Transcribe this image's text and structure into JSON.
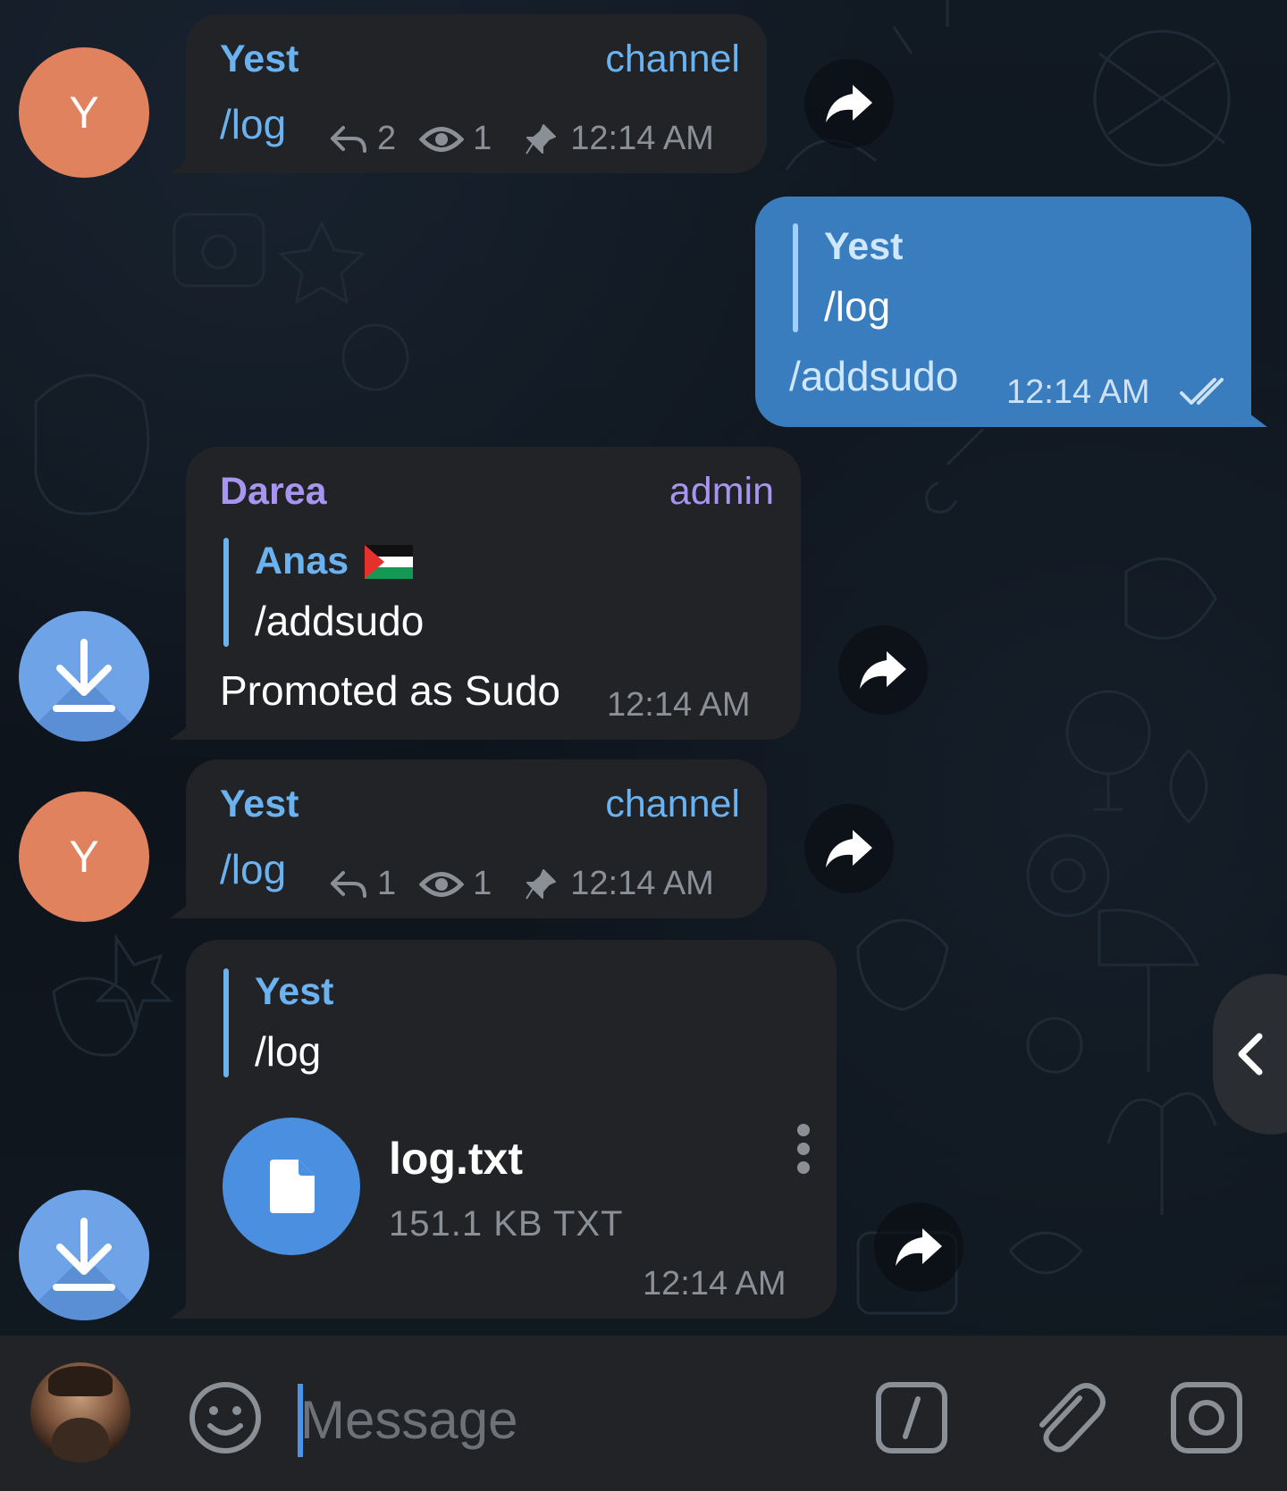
{
  "messages": [
    {
      "sender": "Yest",
      "avatar_letter": "Y",
      "role": "channel",
      "text": "/log",
      "replies": "2",
      "views": "1",
      "time": "12:14 AM"
    },
    {
      "outgoing": true,
      "quote_name": "Yest",
      "quote_text": "/log",
      "text": "/addsudo",
      "time": "12:14 AM",
      "status_icon": "double-check-icon"
    },
    {
      "sender": "Darea",
      "role": "admin",
      "quote_name": "Anas",
      "quote_flag": "palestine-flag-icon",
      "quote_text": "/addsudo",
      "text": "Promoted as Sudo",
      "time": "12:14 AM"
    },
    {
      "sender": "Yest",
      "avatar_letter": "Y",
      "role": "channel",
      "text": "/log",
      "replies": "1",
      "views": "1",
      "time": "12:14 AM"
    },
    {
      "quote_name": "Yest",
      "quote_text": "/log",
      "file_name": "log.txt",
      "file_size": "151.1 KB TXT",
      "time": "12:14 AM"
    }
  ],
  "composer": {
    "placeholder": "Message",
    "value": ""
  },
  "colors": {
    "accent": "#6bb3f0",
    "admin_name": "#a895f0",
    "outgoing_bubble": "#3a7dbf",
    "incoming_bubble": "#212327",
    "avatar_orange": "#e0825d"
  }
}
